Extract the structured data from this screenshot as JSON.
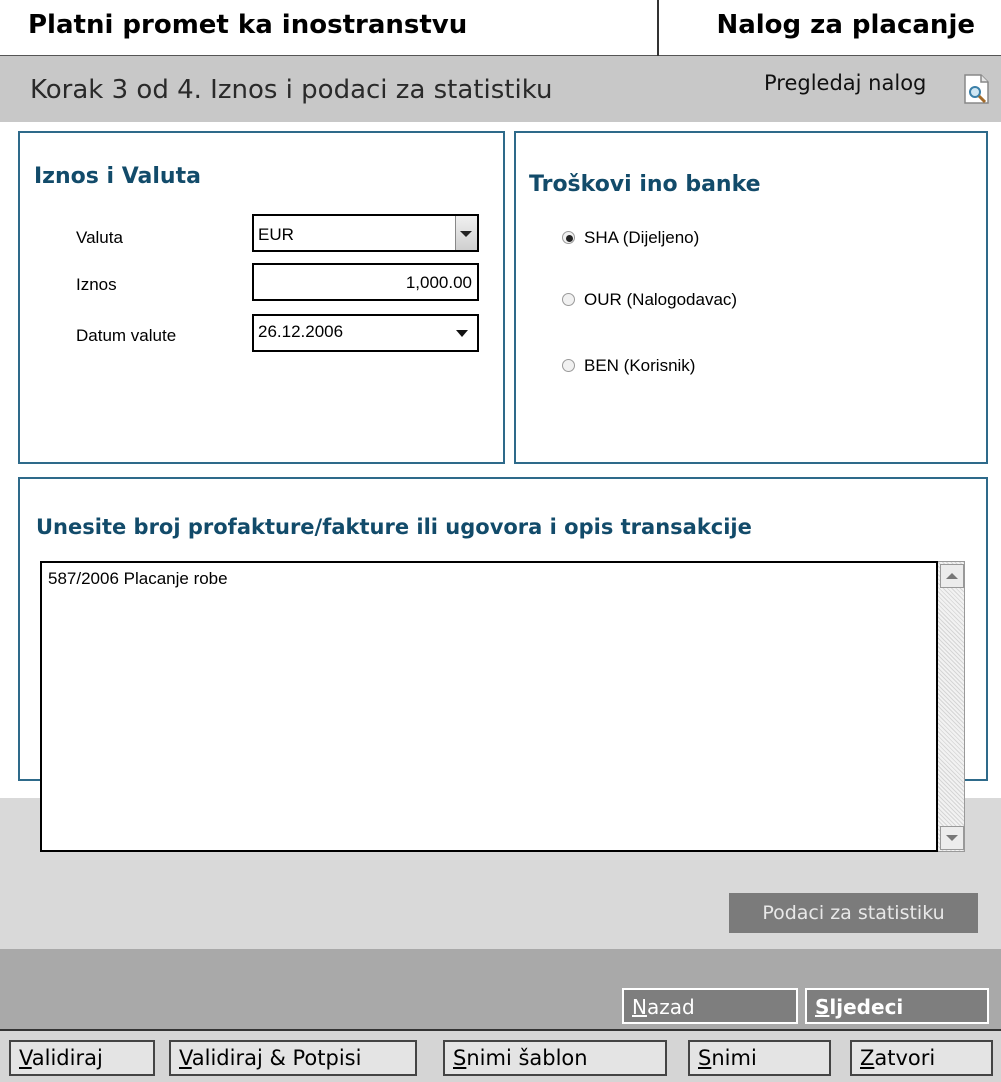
{
  "header": {
    "app_title": "Platni promet ka inostranstvu",
    "doc_title": "Nalog za placanje"
  },
  "step": {
    "text": "Korak 3 od 4. Iznos i podaci za statistiku",
    "preview_label": "Pregledaj nalog",
    "preview_icon": "document-preview-icon"
  },
  "amount_panel": {
    "heading": "Iznos i Valuta",
    "valuta_label": "Valuta",
    "valuta_value": "EUR",
    "iznos_label": "Iznos",
    "iznos_value": "1,000.00",
    "datum_label": "Datum valute",
    "datum_value": "26.12.2006"
  },
  "fees_panel": {
    "heading": "Troškovi ino banke",
    "options": [
      {
        "label": "SHA (Dijeljeno)",
        "selected": true
      },
      {
        "label": "OUR (Nalogodavac)",
        "selected": false
      },
      {
        "label": "BEN (Korisnik)",
        "selected": false
      }
    ]
  },
  "description_panel": {
    "heading": "Unesite broj profakture/fakture ili ugovora i opis transakcije",
    "text": "587/2006 Placanje robe",
    "stat_button": "Podaci za statistiku"
  },
  "nav": {
    "back_rest": "azad",
    "back_key": "N",
    "next_rest": "ljedeci",
    "next_key": "S"
  },
  "toolbar": {
    "validiraj_key": "V",
    "validiraj_rest": "alidiraj",
    "potpisi_key": "V",
    "potpisi_rest": "alidiraj & Potpisi",
    "sablon_key": "S",
    "sablon_rest": "nimi šablon",
    "snimi_key": "S",
    "snimi_rest": "nimi",
    "zatvori_key": "Z",
    "zatvori_rest": "atvori"
  },
  "colors": {
    "panel_border": "#2e6a8a",
    "heading": "#124b6a",
    "disabled_button": "#7b7b7b"
  }
}
